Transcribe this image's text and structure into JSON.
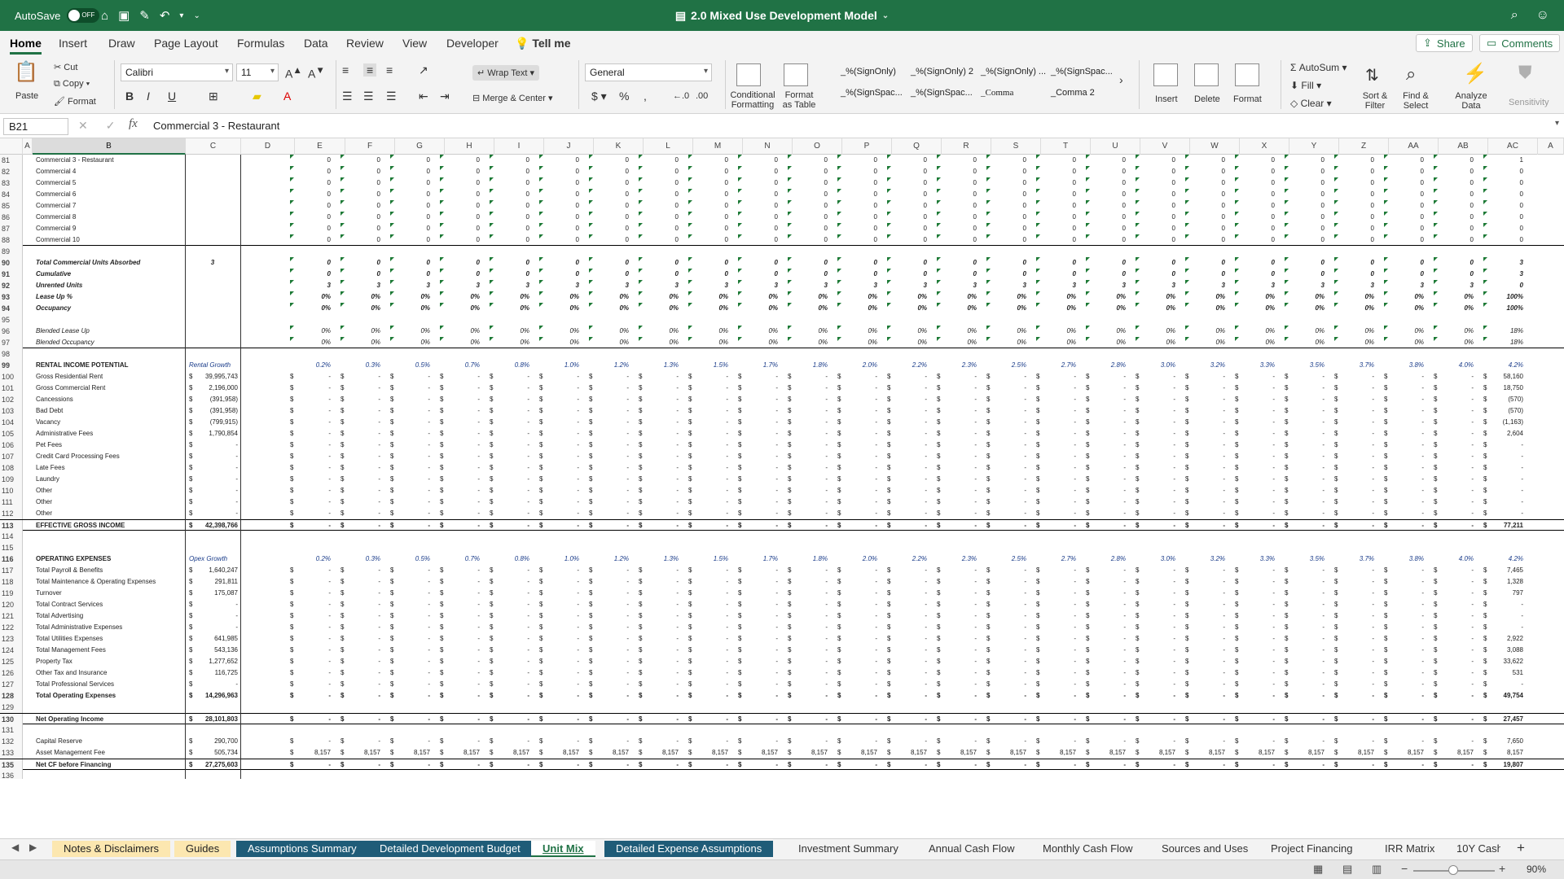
{
  "titlebar": {
    "autosave_label": "AutoSave",
    "autosave_state": "OFF",
    "document_title": "2.0 Mixed Use Development Model",
    "accent": "#207245"
  },
  "ribbon_tabs": [
    "Home",
    "Insert",
    "Draw",
    "Page Layout",
    "Formulas",
    "Data",
    "Review",
    "View",
    "Developer"
  ],
  "tell_me": "Tell me",
  "share_label": "Share",
  "comments_label": "Comments",
  "clipboard": {
    "paste": "Paste",
    "cut": "Cut",
    "copy": "Copy",
    "format": "Format"
  },
  "font": {
    "name": "Calibri",
    "size": "11"
  },
  "alignment": {
    "wrap": "Wrap Text",
    "merge": "Merge & Center"
  },
  "number": {
    "format": "General"
  },
  "styles": {
    "conditional": "Conditional Formatting",
    "format_table": "Format as Table",
    "cells": [
      "_%(SignOnly)",
      "_%(SignOnly) 2",
      "_%(SignOnly) ...",
      "_%(SignSpac...",
      "_%(SignSpac...",
      "_%(SignSpac...",
      "_Comma",
      "_Comma 2"
    ]
  },
  "cells_group": {
    "insert": "Insert",
    "delete": "Delete",
    "format": "Format"
  },
  "editing": {
    "autosum": "AutoSum",
    "fill": "Fill",
    "clear": "Clear",
    "sort": "Sort & Filter",
    "find": "Find & Select",
    "analyze": "Analyze Data",
    "sensitivity": "Sensitivity"
  },
  "formula_bar": {
    "name_box": "B21",
    "fx": "fx",
    "formula": "Commercial 3 - Restaurant"
  },
  "columns": [
    "A",
    "B",
    "C",
    "D",
    "E",
    "F",
    "G",
    "H",
    "I",
    "J",
    "K",
    "L",
    "M",
    "N",
    "O",
    "P",
    "Q",
    "R",
    "S",
    "T",
    "U",
    "V",
    "W",
    "X",
    "Y",
    "Z",
    "AA",
    "AB",
    "AC",
    "A"
  ],
  "rows": [
    {
      "n": "81",
      "label": "Commercial 3 - Restaurant",
      "vals": [
        "0",
        "0",
        "0",
        "0",
        "0",
        "0",
        "0",
        "0",
        "0",
        "0",
        "0",
        "0",
        "0",
        "0",
        "0",
        "0",
        "0",
        "0",
        "0",
        "0",
        "0",
        "0",
        "0",
        "0",
        "1"
      ]
    },
    {
      "n": "82",
      "label": "Commercial 4",
      "vals": [
        "0",
        "0",
        "0",
        "0",
        "0",
        "0",
        "0",
        "0",
        "0",
        "0",
        "0",
        "0",
        "0",
        "0",
        "0",
        "0",
        "0",
        "0",
        "0",
        "0",
        "0",
        "0",
        "0",
        "0",
        "0"
      ]
    },
    {
      "n": "83",
      "label": "Commercial 5",
      "vals": [
        "0",
        "0",
        "0",
        "0",
        "0",
        "0",
        "0",
        "0",
        "0",
        "0",
        "0",
        "0",
        "0",
        "0",
        "0",
        "0",
        "0",
        "0",
        "0",
        "0",
        "0",
        "0",
        "0",
        "0",
        "0"
      ]
    },
    {
      "n": "84",
      "label": "Commercial 6",
      "vals": [
        "0",
        "0",
        "0",
        "0",
        "0",
        "0",
        "0",
        "0",
        "0",
        "0",
        "0",
        "0",
        "0",
        "0",
        "0",
        "0",
        "0",
        "0",
        "0",
        "0",
        "0",
        "0",
        "0",
        "0",
        "0"
      ]
    },
    {
      "n": "85",
      "label": "Commercial 7",
      "vals": [
        "0",
        "0",
        "0",
        "0",
        "0",
        "0",
        "0",
        "0",
        "0",
        "0",
        "0",
        "0",
        "0",
        "0",
        "0",
        "0",
        "0",
        "0",
        "0",
        "0",
        "0",
        "0",
        "0",
        "0",
        "0"
      ]
    },
    {
      "n": "86",
      "label": "Commercial 8",
      "vals": [
        "0",
        "0",
        "0",
        "0",
        "0",
        "0",
        "0",
        "0",
        "0",
        "0",
        "0",
        "0",
        "0",
        "0",
        "0",
        "0",
        "0",
        "0",
        "0",
        "0",
        "0",
        "0",
        "0",
        "0",
        "0"
      ]
    },
    {
      "n": "87",
      "label": "Commercial 9",
      "vals": [
        "0",
        "0",
        "0",
        "0",
        "0",
        "0",
        "0",
        "0",
        "0",
        "0",
        "0",
        "0",
        "0",
        "0",
        "0",
        "0",
        "0",
        "0",
        "0",
        "0",
        "0",
        "0",
        "0",
        "0",
        "0"
      ]
    },
    {
      "n": "88",
      "label": "Commercial 10",
      "vals": [
        "0",
        "0",
        "0",
        "0",
        "0",
        "0",
        "0",
        "0",
        "0",
        "0",
        "0",
        "0",
        "0",
        "0",
        "0",
        "0",
        "0",
        "0",
        "0",
        "0",
        "0",
        "0",
        "0",
        "0",
        "0"
      ],
      "tot": true
    },
    {
      "n": "89",
      "label": ""
    },
    {
      "n": "90",
      "label": "Total Commercial Units Absorbed",
      "c": "3",
      "style": "bi",
      "vals": [
        "0",
        "0",
        "0",
        "0",
        "0",
        "0",
        "0",
        "0",
        "0",
        "0",
        "0",
        "0",
        "0",
        "0",
        "0",
        "0",
        "0",
        "0",
        "0",
        "0",
        "0",
        "0",
        "0",
        "0",
        "3"
      ]
    },
    {
      "n": "91",
      "label": "Cumulative",
      "style": "bi",
      "vals": [
        "0",
        "0",
        "0",
        "0",
        "0",
        "0",
        "0",
        "0",
        "0",
        "0",
        "0",
        "0",
        "0",
        "0",
        "0",
        "0",
        "0",
        "0",
        "0",
        "0",
        "0",
        "0",
        "0",
        "0",
        "3"
      ]
    },
    {
      "n": "92",
      "label": "Unrented Units",
      "style": "bi",
      "vals": [
        "3",
        "3",
        "3",
        "3",
        "3",
        "3",
        "3",
        "3",
        "3",
        "3",
        "3",
        "3",
        "3",
        "3",
        "3",
        "3",
        "3",
        "3",
        "3",
        "3",
        "3",
        "3",
        "3",
        "3",
        "0"
      ]
    },
    {
      "n": "93",
      "label": "Lease Up %",
      "style": "bi",
      "vals": [
        "0%",
        "0%",
        "0%",
        "0%",
        "0%",
        "0%",
        "0%",
        "0%",
        "0%",
        "0%",
        "0%",
        "0%",
        "0%",
        "0%",
        "0%",
        "0%",
        "0%",
        "0%",
        "0%",
        "0%",
        "0%",
        "0%",
        "0%",
        "0%",
        "100%"
      ]
    },
    {
      "n": "94",
      "label": "Occupancy",
      "style": "bi",
      "vals": [
        "0%",
        "0%",
        "0%",
        "0%",
        "0%",
        "0%",
        "0%",
        "0%",
        "0%",
        "0%",
        "0%",
        "0%",
        "0%",
        "0%",
        "0%",
        "0%",
        "0%",
        "0%",
        "0%",
        "0%",
        "0%",
        "0%",
        "0%",
        "0%",
        "100%"
      ]
    },
    {
      "n": "95",
      "label": ""
    },
    {
      "n": "96",
      "label": "Blended Lease Up",
      "style": "i",
      "vals": [
        "0%",
        "0%",
        "0%",
        "0%",
        "0%",
        "0%",
        "0%",
        "0%",
        "0%",
        "0%",
        "0%",
        "0%",
        "0%",
        "0%",
        "0%",
        "0%",
        "0%",
        "0%",
        "0%",
        "0%",
        "0%",
        "0%",
        "0%",
        "0%",
        "18%"
      ]
    },
    {
      "n": "97",
      "label": "Blended Occupancy",
      "style": "i",
      "vals": [
        "0%",
        "0%",
        "0%",
        "0%",
        "0%",
        "0%",
        "0%",
        "0%",
        "0%",
        "0%",
        "0%",
        "0%",
        "0%",
        "0%",
        "0%",
        "0%",
        "0%",
        "0%",
        "0%",
        "0%",
        "0%",
        "0%",
        "0%",
        "0%",
        "18%"
      ],
      "tot": true
    },
    {
      "n": "98",
      "label": ""
    },
    {
      "n": "99",
      "label": "RENTAL INCOME POTENTIAL",
      "c": "Rental Growth",
      "style": "hdr",
      "vals": [
        "0.2%",
        "0.3%",
        "0.5%",
        "0.7%",
        "0.8%",
        "1.0%",
        "1.2%",
        "1.3%",
        "1.5%",
        "1.7%",
        "1.8%",
        "2.0%",
        "2.2%",
        "2.3%",
        "2.5%",
        "2.7%",
        "2.8%",
        "3.0%",
        "3.2%",
        "3.3%",
        "3.5%",
        "3.7%",
        "3.8%",
        "4.0%",
        "4.2%"
      ]
    },
    {
      "n": "100",
      "label": "Gross Residential Rent",
      "c": "39,995,743",
      "dollar": true,
      "last": "58,160"
    },
    {
      "n": "101",
      "label": "Gross Commercial Rent",
      "c": "2,196,000",
      "dollar": true,
      "last": "18,750"
    },
    {
      "n": "102",
      "label": "Cancessions",
      "c": "(391,958)",
      "dollar": true,
      "last": "(570)"
    },
    {
      "n": "103",
      "label": "Bad Debt",
      "c": "(391,958)",
      "dollar": true,
      "last": "(570)"
    },
    {
      "n": "104",
      "label": "Vacancy",
      "c": "(799,915)",
      "dollar": true,
      "last": "(1,163)"
    },
    {
      "n": "105",
      "label": "Administrative Fees",
      "c": "1,790,854",
      "dollar": true,
      "last": "2,604"
    },
    {
      "n": "106",
      "label": "Pet Fees",
      "c": "-",
      "dollar": true,
      "last": "-"
    },
    {
      "n": "107",
      "label": "Credit Card Processing Fees",
      "c": "-",
      "dollar": true,
      "last": "-"
    },
    {
      "n": "108",
      "label": "Late Fees",
      "c": "-",
      "dollar": true,
      "last": "-"
    },
    {
      "n": "109",
      "label": "Laundry",
      "c": "-",
      "dollar": true,
      "last": "-"
    },
    {
      "n": "110",
      "label": "Other",
      "c": "-",
      "dollar": true,
      "last": "-"
    },
    {
      "n": "111",
      "label": "Other",
      "c": "-",
      "dollar": true,
      "last": "-"
    },
    {
      "n": "112",
      "label": "Other",
      "c": "-",
      "dollar": true,
      "last": "-"
    },
    {
      "n": "113",
      "label": "EFFECTIVE GROSS INCOME",
      "c": "42,398,766",
      "dollar": true,
      "last": "77,211",
      "style": "b",
      "tot2": true
    },
    {
      "n": "114",
      "label": ""
    },
    {
      "n": "115",
      "label": ""
    },
    {
      "n": "116",
      "label": "OPERATING EXPENSES",
      "c": "Opex Growth",
      "style": "hdr",
      "vals": [
        "0.2%",
        "0.3%",
        "0.5%",
        "0.7%",
        "0.8%",
        "1.0%",
        "1.2%",
        "1.3%",
        "1.5%",
        "1.7%",
        "1.8%",
        "2.0%",
        "2.2%",
        "2.3%",
        "2.5%",
        "2.7%",
        "2.8%",
        "3.0%",
        "3.2%",
        "3.3%",
        "3.5%",
        "3.7%",
        "3.8%",
        "4.0%",
        "4.2%"
      ]
    },
    {
      "n": "117",
      "label": "Total Payroll & Benefits",
      "c": "1,640,247",
      "dollar": true,
      "last": "7,465"
    },
    {
      "n": "118",
      "label": "Total Maintenance & Operating Expenses",
      "c": "291,811",
      "dollar": true,
      "last": "1,328"
    },
    {
      "n": "119",
      "label": "Turnover",
      "c": "175,087",
      "dollar": true,
      "last": "797"
    },
    {
      "n": "120",
      "label": "Total Contract Services",
      "c": "-",
      "dollar": true,
      "last": "-"
    },
    {
      "n": "121",
      "label": "Total Advertising",
      "c": "-",
      "dollar": true,
      "last": "-"
    },
    {
      "n": "122",
      "label": "Total Administrative Expenses",
      "c": "-",
      "dollar": true,
      "last": "-"
    },
    {
      "n": "123",
      "label": "Total Utilities Expenses",
      "c": "641,985",
      "dollar": true,
      "last": "2,922"
    },
    {
      "n": "124",
      "label": "Total Management Fees",
      "c": "543,136",
      "dollar": true,
      "last": "3,088"
    },
    {
      "n": "125",
      "label": "Property Tax",
      "c": "1,277,652",
      "dollar": true,
      "last": "33,622"
    },
    {
      "n": "126",
      "label": "Other Tax and Insurance",
      "c": "116,725",
      "dollar": true,
      "last": "531"
    },
    {
      "n": "127",
      "label": "Total Professional Services",
      "c": "-",
      "dollar": true,
      "last": "-"
    },
    {
      "n": "128",
      "label": "Total Operating Expenses",
      "c": "14,296,963",
      "dollar": true,
      "last": "49,754",
      "style": "b"
    },
    {
      "n": "129",
      "label": ""
    },
    {
      "n": "130",
      "label": "Net Operating Income",
      "c": "28,101,803",
      "dollar": true,
      "last": "27,457",
      "style": "b",
      "tot2": true
    },
    {
      "n": "131",
      "label": ""
    },
    {
      "n": "132",
      "label": "Capital Reserve",
      "c": "290,700",
      "dollar": true,
      "last": "7,650"
    },
    {
      "n": "133",
      "label": "Asset Management Fee",
      "c": "505,734",
      "dollar": true,
      "mid": "8,157",
      "last": "8,157"
    },
    {
      "n": "135",
      "label": "Net CF before Financing",
      "c": "27,275,603",
      "dollar": true,
      "last": "19,807",
      "style": "b",
      "tot2": true
    },
    {
      "n": "136",
      "label": ""
    },
    {
      "n": "137",
      "label": ""
    },
    {
      "n": "138",
      "label": ""
    },
    {
      "n": "139",
      "label": ""
    },
    {
      "n": "140",
      "label": ""
    }
  ],
  "sheet_tabs": [
    {
      "label": "Notes & Disclaimers",
      "style": "cream"
    },
    {
      "label": "Guides",
      "style": "cream"
    },
    {
      "label": "Assumptions Summary",
      "style": "fill"
    },
    {
      "label": "Detailed Development Budget",
      "style": "fill"
    },
    {
      "label": "Unit Mix",
      "style": "active"
    },
    {
      "label": "Detailed Expense Assumptions",
      "style": "fill"
    },
    {
      "label": "Investment Summary",
      "style": "plain"
    },
    {
      "label": "Annual Cash Flow",
      "style": "plain"
    },
    {
      "label": "Monthly Cash Flow",
      "style": "plain"
    },
    {
      "label": "Sources and Uses",
      "style": "plain"
    },
    {
      "label": "Project Financing",
      "style": "plain"
    },
    {
      "label": "IRR Matrix",
      "style": "plain"
    },
    {
      "label": "10Y Cash",
      "style": "plain"
    }
  ],
  "status": {
    "zoom": "90%"
  }
}
